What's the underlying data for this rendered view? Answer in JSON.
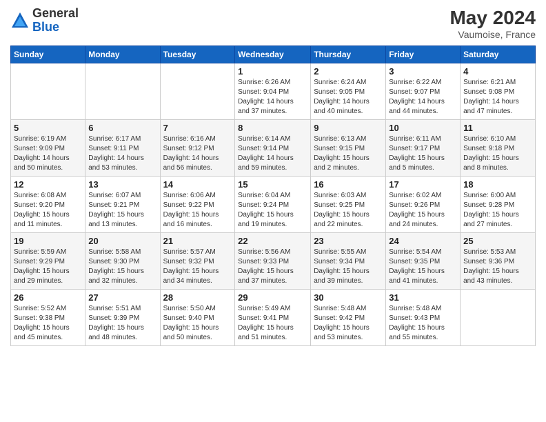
{
  "logo": {
    "general": "General",
    "blue": "Blue"
  },
  "title": {
    "month_year": "May 2024",
    "location": "Vaumoise, France"
  },
  "days_header": [
    "Sunday",
    "Monday",
    "Tuesday",
    "Wednesday",
    "Thursday",
    "Friday",
    "Saturday"
  ],
  "weeks": [
    [
      {
        "day": "",
        "info": ""
      },
      {
        "day": "",
        "info": ""
      },
      {
        "day": "",
        "info": ""
      },
      {
        "day": "1",
        "info": "Sunrise: 6:26 AM\nSunset: 9:04 PM\nDaylight: 14 hours\nand 37 minutes."
      },
      {
        "day": "2",
        "info": "Sunrise: 6:24 AM\nSunset: 9:05 PM\nDaylight: 14 hours\nand 40 minutes."
      },
      {
        "day": "3",
        "info": "Sunrise: 6:22 AM\nSunset: 9:07 PM\nDaylight: 14 hours\nand 44 minutes."
      },
      {
        "day": "4",
        "info": "Sunrise: 6:21 AM\nSunset: 9:08 PM\nDaylight: 14 hours\nand 47 minutes."
      }
    ],
    [
      {
        "day": "5",
        "info": "Sunrise: 6:19 AM\nSunset: 9:09 PM\nDaylight: 14 hours\nand 50 minutes."
      },
      {
        "day": "6",
        "info": "Sunrise: 6:17 AM\nSunset: 9:11 PM\nDaylight: 14 hours\nand 53 minutes."
      },
      {
        "day": "7",
        "info": "Sunrise: 6:16 AM\nSunset: 9:12 PM\nDaylight: 14 hours\nand 56 minutes."
      },
      {
        "day": "8",
        "info": "Sunrise: 6:14 AM\nSunset: 9:14 PM\nDaylight: 14 hours\nand 59 minutes."
      },
      {
        "day": "9",
        "info": "Sunrise: 6:13 AM\nSunset: 9:15 PM\nDaylight: 15 hours\nand 2 minutes."
      },
      {
        "day": "10",
        "info": "Sunrise: 6:11 AM\nSunset: 9:17 PM\nDaylight: 15 hours\nand 5 minutes."
      },
      {
        "day": "11",
        "info": "Sunrise: 6:10 AM\nSunset: 9:18 PM\nDaylight: 15 hours\nand 8 minutes."
      }
    ],
    [
      {
        "day": "12",
        "info": "Sunrise: 6:08 AM\nSunset: 9:20 PM\nDaylight: 15 hours\nand 11 minutes."
      },
      {
        "day": "13",
        "info": "Sunrise: 6:07 AM\nSunset: 9:21 PM\nDaylight: 15 hours\nand 13 minutes."
      },
      {
        "day": "14",
        "info": "Sunrise: 6:06 AM\nSunset: 9:22 PM\nDaylight: 15 hours\nand 16 minutes."
      },
      {
        "day": "15",
        "info": "Sunrise: 6:04 AM\nSunset: 9:24 PM\nDaylight: 15 hours\nand 19 minutes."
      },
      {
        "day": "16",
        "info": "Sunrise: 6:03 AM\nSunset: 9:25 PM\nDaylight: 15 hours\nand 22 minutes."
      },
      {
        "day": "17",
        "info": "Sunrise: 6:02 AM\nSunset: 9:26 PM\nDaylight: 15 hours\nand 24 minutes."
      },
      {
        "day": "18",
        "info": "Sunrise: 6:00 AM\nSunset: 9:28 PM\nDaylight: 15 hours\nand 27 minutes."
      }
    ],
    [
      {
        "day": "19",
        "info": "Sunrise: 5:59 AM\nSunset: 9:29 PM\nDaylight: 15 hours\nand 29 minutes."
      },
      {
        "day": "20",
        "info": "Sunrise: 5:58 AM\nSunset: 9:30 PM\nDaylight: 15 hours\nand 32 minutes."
      },
      {
        "day": "21",
        "info": "Sunrise: 5:57 AM\nSunset: 9:32 PM\nDaylight: 15 hours\nand 34 minutes."
      },
      {
        "day": "22",
        "info": "Sunrise: 5:56 AM\nSunset: 9:33 PM\nDaylight: 15 hours\nand 37 minutes."
      },
      {
        "day": "23",
        "info": "Sunrise: 5:55 AM\nSunset: 9:34 PM\nDaylight: 15 hours\nand 39 minutes."
      },
      {
        "day": "24",
        "info": "Sunrise: 5:54 AM\nSunset: 9:35 PM\nDaylight: 15 hours\nand 41 minutes."
      },
      {
        "day": "25",
        "info": "Sunrise: 5:53 AM\nSunset: 9:36 PM\nDaylight: 15 hours\nand 43 minutes."
      }
    ],
    [
      {
        "day": "26",
        "info": "Sunrise: 5:52 AM\nSunset: 9:38 PM\nDaylight: 15 hours\nand 45 minutes."
      },
      {
        "day": "27",
        "info": "Sunrise: 5:51 AM\nSunset: 9:39 PM\nDaylight: 15 hours\nand 48 minutes."
      },
      {
        "day": "28",
        "info": "Sunrise: 5:50 AM\nSunset: 9:40 PM\nDaylight: 15 hours\nand 50 minutes."
      },
      {
        "day": "29",
        "info": "Sunrise: 5:49 AM\nSunset: 9:41 PM\nDaylight: 15 hours\nand 51 minutes."
      },
      {
        "day": "30",
        "info": "Sunrise: 5:48 AM\nSunset: 9:42 PM\nDaylight: 15 hours\nand 53 minutes."
      },
      {
        "day": "31",
        "info": "Sunrise: 5:48 AM\nSunset: 9:43 PM\nDaylight: 15 hours\nand 55 minutes."
      },
      {
        "day": "",
        "info": ""
      }
    ]
  ]
}
